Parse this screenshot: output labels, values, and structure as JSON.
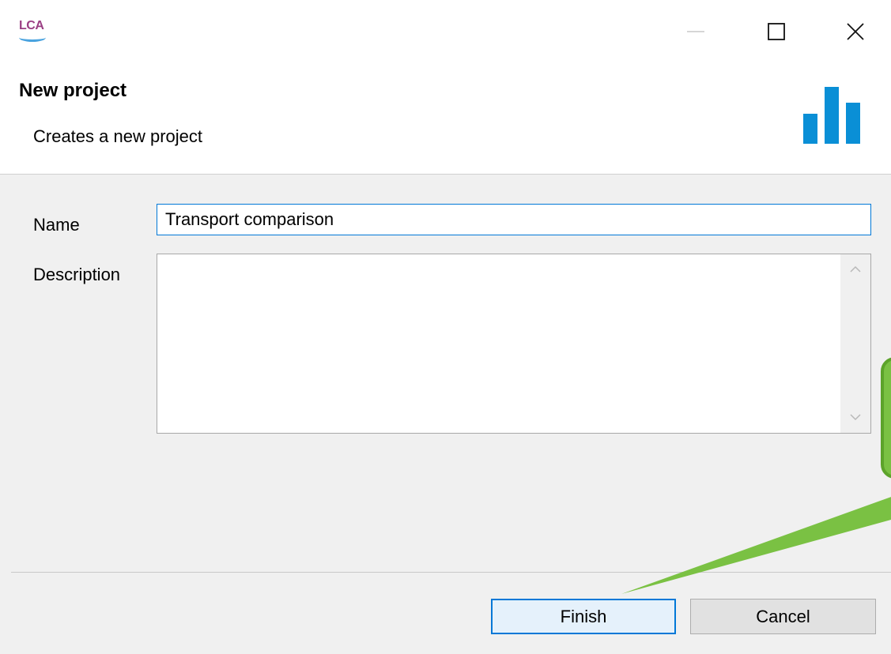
{
  "window": {
    "app_logo_text": "LCA",
    "controls": {
      "minimize_icon": "minimize-icon",
      "maximize_icon": "maximize-icon",
      "close_icon": "close-icon"
    }
  },
  "banner": {
    "title": "New project",
    "subtitle": "Creates a new project",
    "icon": "bar-chart-icon",
    "icon_color": "#0a8fd6"
  },
  "form": {
    "name_label": "Name",
    "name_value": "Transport comparison",
    "description_label": "Description",
    "description_value": ""
  },
  "buttons": {
    "finish_label": "Finish",
    "cancel_label": "Cancel"
  },
  "annotation": {
    "color": "#7ac143",
    "icon": "callout-pointer"
  }
}
